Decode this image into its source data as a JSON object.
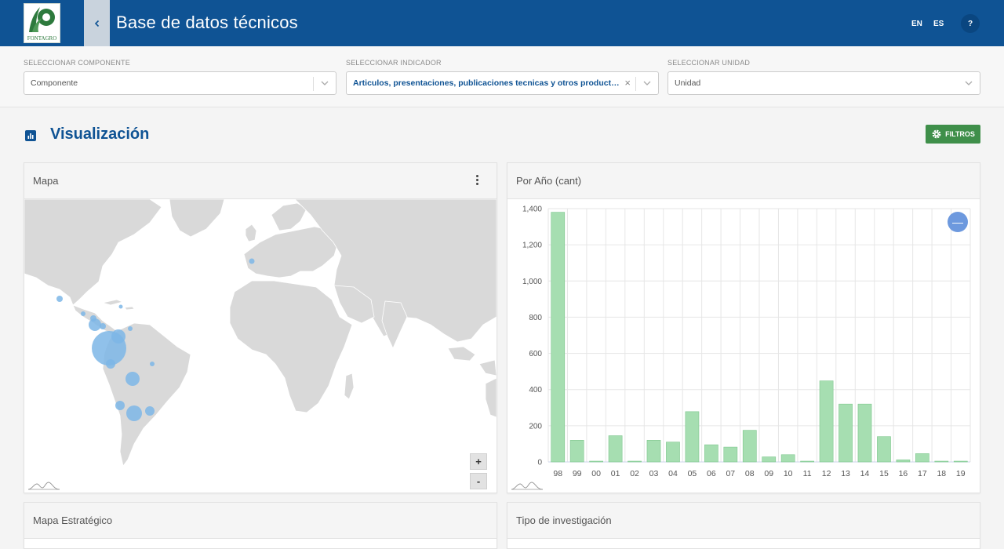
{
  "header": {
    "logo_text": "FONTAGRO",
    "title": "Base de datos técnicos",
    "lang_en": "EN",
    "lang_es": "ES",
    "help_label": "?"
  },
  "selectors": [
    {
      "label": "SELECCIONAR COMPONENTE",
      "value": "Componente"
    },
    {
      "label": "SELECCIONAR INDICADOR",
      "value": "Articulos, presentaciones, publicaciones tecnicas y otros productos d..."
    },
    {
      "label": "SELECCIONAR UNIDAD",
      "value": "Unidad"
    }
  ],
  "section": {
    "title": "Visualización",
    "filters_label": "FILTROS"
  },
  "cards": {
    "map_title": "Mapa",
    "chart_title": "Por Año (cant)",
    "bottom_left_title": "Mapa Estratégico",
    "bottom_right_title": "Tipo de investigación"
  },
  "map": {
    "zoom_in": "+",
    "zoom_out": "-",
    "bubble_color": "#7db6e6",
    "land_color": "#d9d9d9"
  },
  "chart_data": {
    "type": "bar",
    "categories": [
      "98",
      "99",
      "00",
      "01",
      "02",
      "03",
      "04",
      "05",
      "06",
      "07",
      "08",
      "09",
      "10",
      "11",
      "12",
      "13",
      "14",
      "15",
      "16",
      "17",
      "18",
      "19"
    ],
    "values": [
      1380,
      120,
      0,
      145,
      0,
      120,
      110,
      278,
      95,
      82,
      175,
      28,
      40,
      0,
      448,
      320,
      320,
      140,
      12,
      46,
      0,
      0
    ],
    "yticks": [
      "0",
      "200",
      "400",
      "600",
      "800",
      "1,000",
      "1,200",
      "1,400"
    ],
    "ylim": [
      0,
      1400
    ],
    "bar_color": "#a6deb1",
    "bar_border": "#7ec78e",
    "grid": true,
    "reset_label": "—"
  }
}
